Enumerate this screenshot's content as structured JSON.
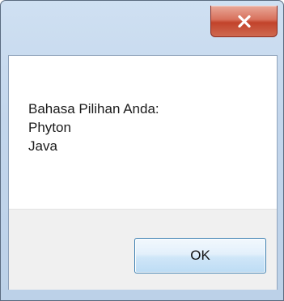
{
  "dialog": {
    "title": "",
    "message_lines": [
      "Bahasa Pilihan Anda:",
      "Phyton",
      "Java"
    ],
    "ok_label": "OK"
  },
  "icons": {
    "close": "close-icon"
  },
  "colors": {
    "close_button": "#c2432b",
    "ok_button_border": "#3c7fb1",
    "footer": "#f0f0f0",
    "frame": "#c3d6ec"
  }
}
